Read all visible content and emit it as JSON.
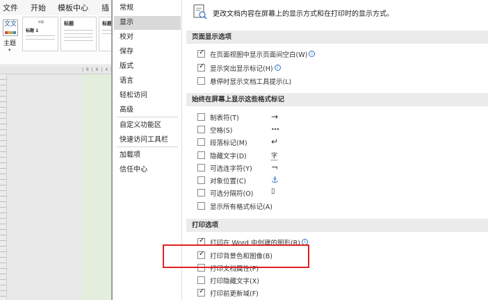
{
  "word": {
    "tabs": [
      "文件",
      "开始",
      "模板中心",
      "插"
    ],
    "theme_icon_text": "文文",
    "theme_label": "主题",
    "style_thumbs": [
      {
        "heading": "标题",
        "sub": "标题 1"
      },
      {
        "heading": "标题",
        "sub": ""
      },
      {
        "heading": "标题",
        "sub": ""
      }
    ],
    "ruler_text": "| 8 | 6 | 4 |"
  },
  "nav": {
    "items": [
      "常规",
      "显示",
      "校对",
      "保存",
      "版式",
      "语言",
      "轻松访问",
      "高级",
      "自定义功能区",
      "快速访问工具栏",
      "加载项",
      "信任中心"
    ],
    "selected_index": 1
  },
  "content": {
    "header_text": "更改文档内容在屏幕上的显示方式和在打印时的显示方式。",
    "section_page_display": {
      "title": "页面显示选项",
      "options": [
        {
          "label": "在页面视图中显示页面间空白(W)",
          "checked": true,
          "info": true
        },
        {
          "label": "显示突出显示标记(H)",
          "checked": true,
          "info": true
        },
        {
          "label": "悬停时显示文档工具提示(L)",
          "checked": false,
          "info": false
        }
      ]
    },
    "section_format_marks": {
      "title": "始终在屏幕上显示这些格式标记",
      "options": [
        {
          "label": "制表符(T)",
          "checked": false,
          "symbol": "→"
        },
        {
          "label": "空格(S)",
          "checked": false,
          "symbol": "•••"
        },
        {
          "label": "段落标记(M)",
          "checked": false,
          "symbol": "↵"
        },
        {
          "label": "隐藏文字(D)",
          "checked": false,
          "symbol": "字"
        },
        {
          "label": "可选连字符(Y)",
          "checked": false,
          "symbol": "¬"
        },
        {
          "label": "对象位置(C)",
          "checked": false,
          "symbol": "⚓"
        },
        {
          "label": "可选分隔符(O)",
          "checked": false,
          "symbol": "▯"
        },
        {
          "label": "显示所有格式标记(A)",
          "checked": false,
          "symbol": ""
        }
      ]
    },
    "section_print": {
      "title": "打印选项",
      "options": [
        {
          "label": "打印在 Word 中创建的图形(R)",
          "checked": true,
          "info": true
        },
        {
          "label": "打印背景色和图像(B)",
          "checked": true,
          "info": false
        },
        {
          "label": "打印文档属性(P)",
          "checked": false,
          "info": false
        },
        {
          "label": "打印隐藏文字(X)",
          "checked": false,
          "info": false
        },
        {
          "label": "打印前更新域(F)",
          "checked": true,
          "info": false
        }
      ]
    }
  },
  "colors": {
    "highlight_box": "#e02020",
    "nav_selected_bg": "#d9d9d9",
    "section_header_bg": "#ebebeb",
    "info_icon": "#2f6fc8"
  }
}
